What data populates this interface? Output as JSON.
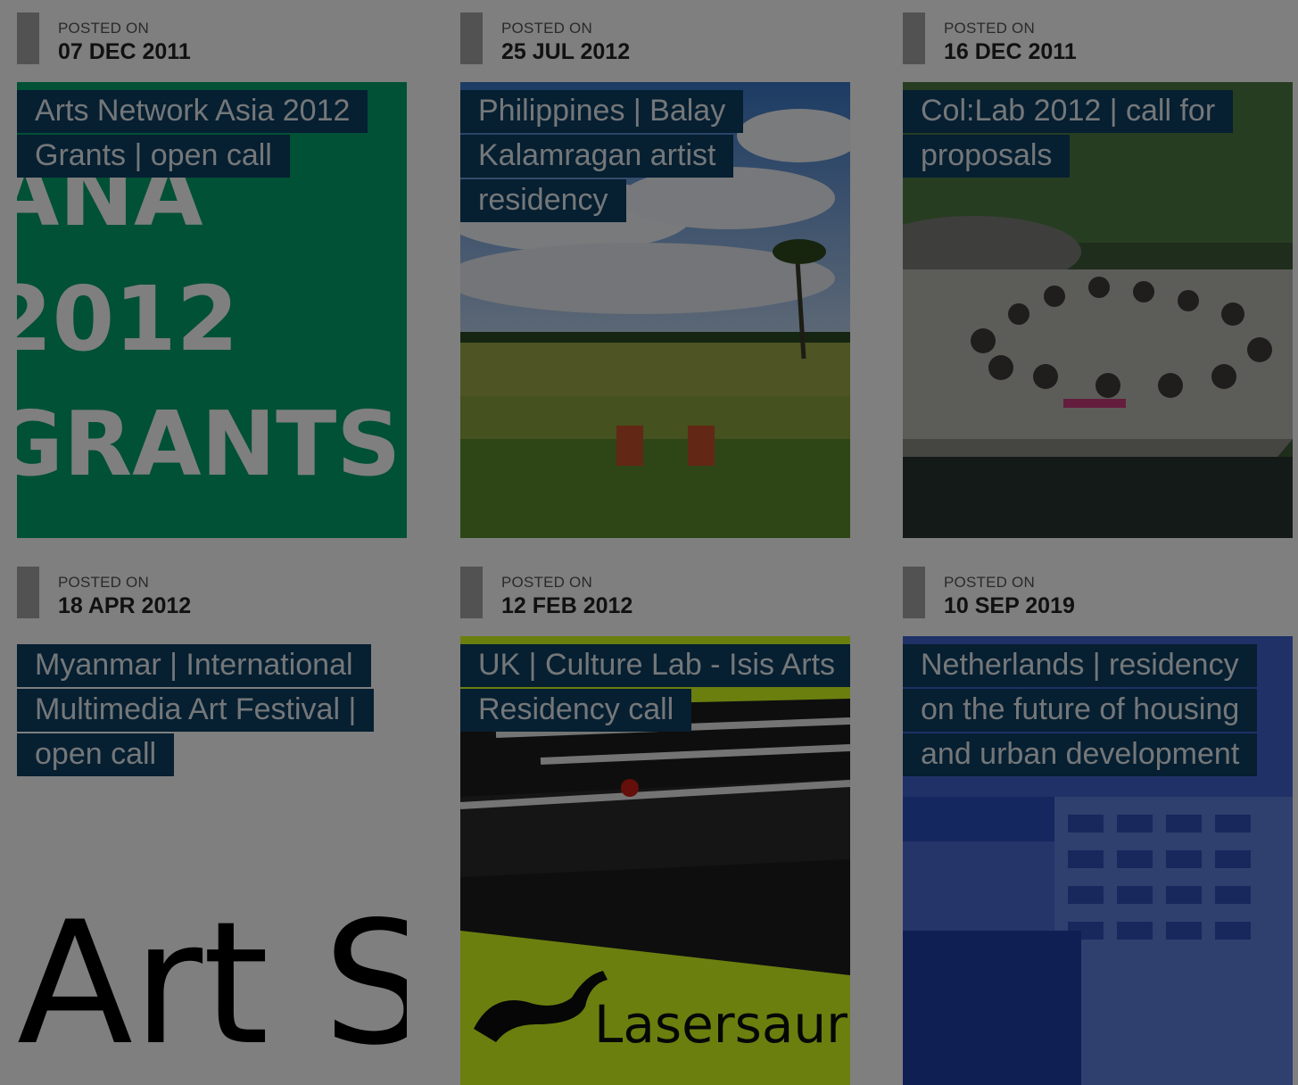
{
  "posts": [
    {
      "posted_label": "POSTED ON",
      "date": "07 DEC 2011",
      "title": "Arts Network Asia 2012 Grants | open call",
      "image_text": [
        "ANA",
        "2012",
        "GRANTS"
      ]
    },
    {
      "posted_label": "POSTED ON",
      "date": "25 JUL 2012",
      "title": "Philippines | Balay Kalamragan artist residency"
    },
    {
      "posted_label": "POSTED ON",
      "date": "16 DEC 2011",
      "title": "Col:Lab 2012 | call for proposals"
    },
    {
      "posted_label": "POSTED ON",
      "date": "18 APR 2012",
      "title": "Myanmar | International Multimedia Art Festival | open call",
      "image_text": "Art S"
    },
    {
      "posted_label": "POSTED ON",
      "date": "12 FEB 2012",
      "title": "UK | Culture Lab - Isis Arts Residency call",
      "image_text": "Lasersaur"
    },
    {
      "posted_label": "POSTED ON",
      "date": "10 SEP 2019",
      "title": "Netherlands | residency on the future of housing and urban development"
    }
  ],
  "colors": {
    "title_bg": "#0d3f63",
    "meta_bar": "#a5a5a5",
    "overlay": "rgba(0,0,0,0.5)"
  }
}
